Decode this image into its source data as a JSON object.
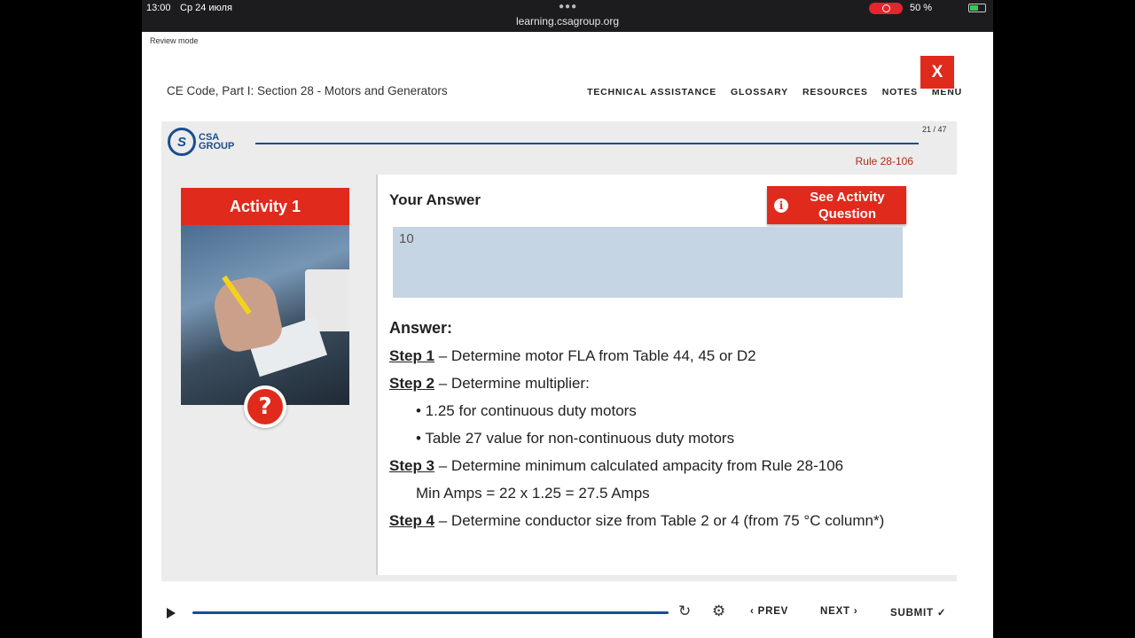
{
  "status_bar": {
    "time": "13:00",
    "date": "Ср 24 июля",
    "url": "learning.csagroup.org",
    "battery": "50 %"
  },
  "review_mode": "Review mode",
  "course_title": "CE Code, Part I: Section 28 - Motors and Generators",
  "topnav": [
    "TECHNICAL ASSISTANCE",
    "GLOSSARY",
    "RESOURCES",
    "NOTES",
    "MENU"
  ],
  "logo": {
    "mark": "S",
    "line1": "CSA",
    "line2": "GROUP"
  },
  "counter": "21 / 47",
  "rule": "Rule 28-106",
  "activity": {
    "title": "Activity 1",
    "question_mark": "?"
  },
  "your_answer": {
    "heading": "Your Answer",
    "value": "10"
  },
  "see_activity": {
    "label": "See Activity Question",
    "icon": "i"
  },
  "close": {
    "label": "X"
  },
  "answer": {
    "heading": "Answer:",
    "step1_label": "Step 1",
    "step1_text": " – Determine motor FLA from Table 44, 45 or D2",
    "step2_label": "Step 2",
    "step2_text": " – Determine multiplier:",
    "bullet1": "• 1.25 for continuous duty motors",
    "bullet2": "• Table 27 value for non-continuous duty motors",
    "step3_label": "Step 3",
    "step3_text": " – Determine minimum calculated ampacity from Rule 28-106",
    "step3_calc": "Min Amps = 22 x 1.25 = 27.5 Amps",
    "step4_label": "Step 4",
    "step4_text": " – Determine conductor size from Table 2 or 4 (from 75 °C column*)"
  },
  "controls": {
    "prev": "‹ PREV",
    "next": "NEXT ›",
    "submit": "SUBMIT ✓",
    "reload_icon": "↻",
    "settings_icon": "⚙"
  }
}
